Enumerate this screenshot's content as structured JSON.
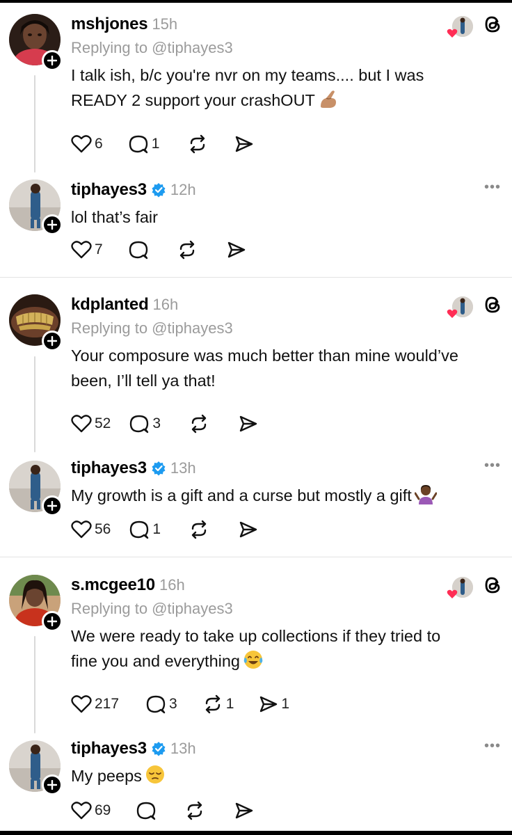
{
  "threads": [
    {
      "reply": {
        "username": "mshjones",
        "time": "15h",
        "replying_to": "Replying to @tiphayes3",
        "text_line1": "I talk ish, b/c you're nvr on my teams.... but I was",
        "text_line2": "READY 2 support your crashOUT",
        "emoji_icon": "pinching-hand-emoji",
        "likes": "6",
        "replies": "1",
        "reposts": "",
        "shares": ""
      },
      "response": {
        "username": "tiphayes3",
        "time": "12h",
        "text": "lol that’s fair",
        "likes": "7",
        "replies": "",
        "reposts": "",
        "shares": ""
      }
    },
    {
      "reply": {
        "username": "kdplanted",
        "time": "16h",
        "replying_to": "Replying to @tiphayes3",
        "text_line1": "Your composure was much better than mine would’ve",
        "text_line2": "been, I’ll tell ya that!",
        "emoji_icon": "",
        "likes": "52",
        "replies": "3",
        "reposts": "",
        "shares": ""
      },
      "response": {
        "username": "tiphayes3",
        "time": "13h",
        "text": "My growth is a gift and a curse but mostly a gift",
        "emoji_icon": "person-shrugging-emoji",
        "likes": "56",
        "replies": "1",
        "reposts": "",
        "shares": ""
      }
    },
    {
      "reply": {
        "username": "s.mcgee10",
        "time": "16h",
        "replying_to": "Replying to @tiphayes3",
        "text_line1": "We were ready to take up collections if they tried to",
        "text_line2": "fine you and everything",
        "emoji_icon": "tears-of-joy-emoji",
        "likes": "217",
        "replies": "3",
        "reposts": "1",
        "shares": "1"
      },
      "response": {
        "username": "tiphayes3",
        "time": "13h",
        "text": "My peeps",
        "emoji_icon": "pensive-face-emoji",
        "likes": "69",
        "replies": "",
        "reposts": "",
        "shares": ""
      }
    }
  ],
  "more_label": "•••",
  "colors": {
    "verified": "#1d9bf0",
    "heart_badge": "#ff2d55",
    "secondary_text": "#9b9b9b",
    "thread_line": "#d9d9d9"
  }
}
